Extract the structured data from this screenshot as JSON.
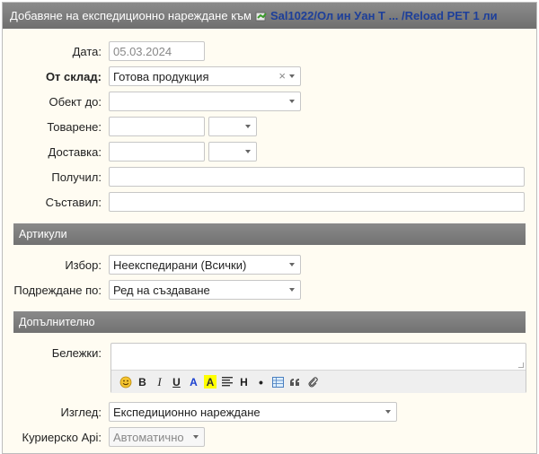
{
  "window": {
    "title_prefix": "Добавяне на експедиционно нареждане към",
    "title_link": "Sal1022/Ол ин Уан Т ... /Reload PET 1 ли"
  },
  "form": {
    "date": {
      "label": "Дата:",
      "value": "05.03.2024"
    },
    "warehouse": {
      "label": "От склад:",
      "value": "Готова продукция",
      "clear": "×"
    },
    "destination": {
      "label": "Обект до:",
      "value": ""
    },
    "loading": {
      "label": "Товарене:",
      "value": "",
      "time": ""
    },
    "delivery": {
      "label": "Доставка:",
      "value": "",
      "time": ""
    },
    "received_by": {
      "label": "Получил:",
      "value": ""
    },
    "composed_by": {
      "label": "Съставил:",
      "value": ""
    }
  },
  "sections": {
    "articles": "Артикули",
    "additional": "Допълнително"
  },
  "articles": {
    "choice": {
      "label": "Избор:",
      "value": "Неекспедирани (Всички)"
    },
    "ordering": {
      "label": "Подреждане по:",
      "value": "Ред на създаване"
    }
  },
  "additional": {
    "notes": {
      "label": "Бележки:",
      "value": ""
    },
    "toolbar": {
      "bold": "B",
      "italic": "I",
      "underline": "U",
      "text_color": "A",
      "highlight": "A",
      "heading": "H",
      "bullet": "•"
    },
    "view": {
      "label": "Изглед:",
      "value": "Експедиционно нареждане"
    },
    "courier": {
      "label": "Куриерско Api:",
      "value": "Автоматично"
    }
  },
  "colors": {
    "title_link": "#1d3f9a",
    "form_background": "#fffcf2",
    "section_header": "#7c7c7c",
    "highlight_yellow": "#ffff00",
    "text_color_blue": "#1a3fd0"
  }
}
